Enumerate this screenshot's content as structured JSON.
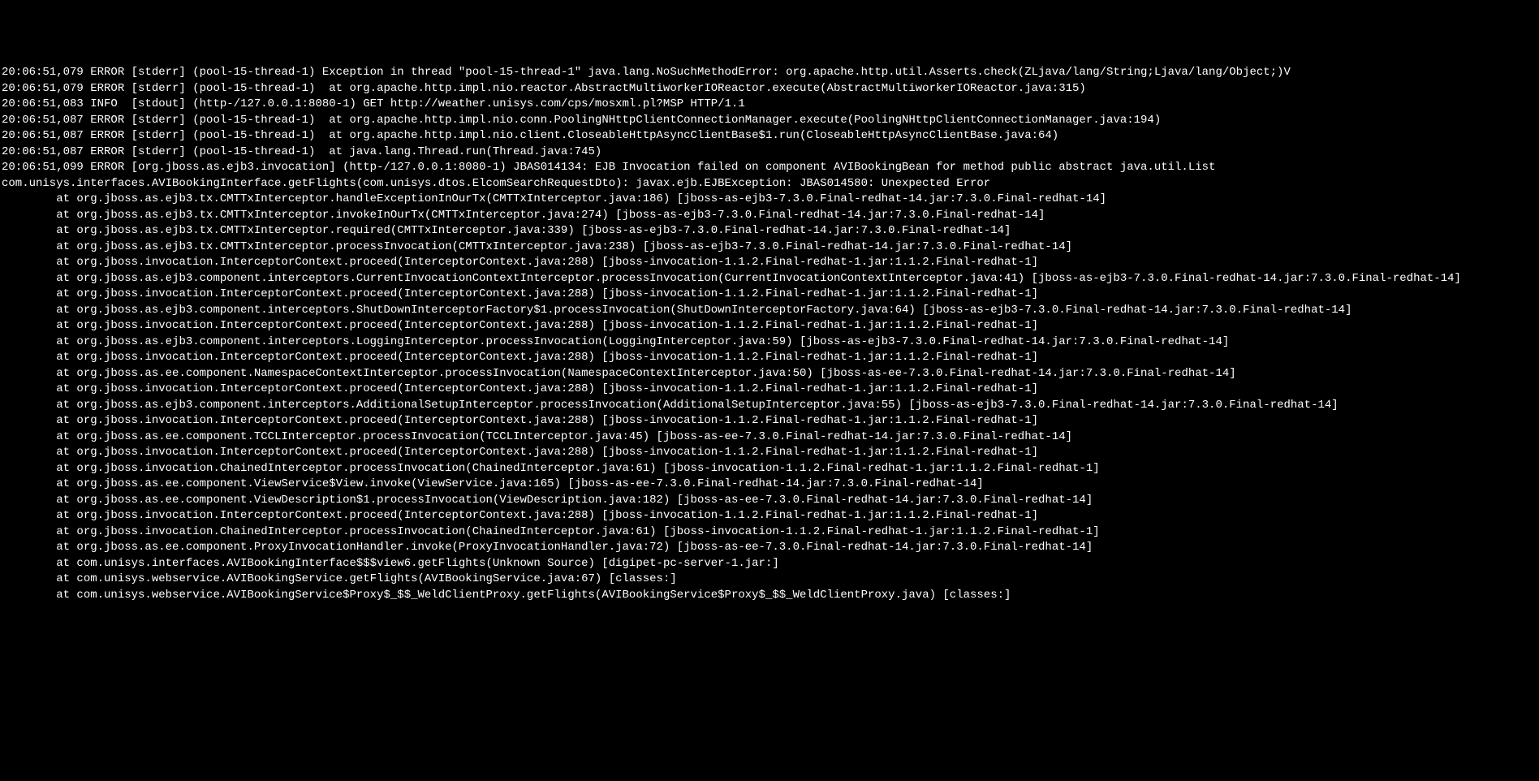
{
  "logLines": [
    "20:06:51,079 ERROR [stderr] (pool-15-thread-1) Exception in thread \"pool-15-thread-1\" java.lang.NoSuchMethodError: org.apache.http.util.Asserts.check(ZLjava/lang/String;Ljava/lang/Object;)V",
    "20:06:51,079 ERROR [stderr] (pool-15-thread-1)  at org.apache.http.impl.nio.reactor.AbstractMultiworkerIOReactor.execute(AbstractMultiworkerIOReactor.java:315)",
    "20:06:51,083 INFO  [stdout] (http-/127.0.0.1:8080-1) GET http://weather.unisys.com/cps/mosxml.pl?MSP HTTP/1.1",
    "20:06:51,087 ERROR [stderr] (pool-15-thread-1)  at org.apache.http.impl.nio.conn.PoolingNHttpClientConnectionManager.execute(PoolingNHttpClientConnectionManager.java:194)",
    "20:06:51,087 ERROR [stderr] (pool-15-thread-1)  at org.apache.http.impl.nio.client.CloseableHttpAsyncClientBase$1.run(CloseableHttpAsyncClientBase.java:64)",
    "20:06:51,087 ERROR [stderr] (pool-15-thread-1)  at java.lang.Thread.run(Thread.java:745)",
    "20:06:51,099 ERROR [org.jboss.as.ejb3.invocation] (http-/127.0.0.1:8080-1) JBAS014134: EJB Invocation failed on component AVIBookingBean for method public abstract java.util.List com.unisys.interfaces.AVIBookingInterface.getFlights(com.unisys.dtos.ElcomSearchRequestDto): javax.ejb.EJBException: JBAS014580: Unexpected Error",
    "        at org.jboss.as.ejb3.tx.CMTTxInterceptor.handleExceptionInOurTx(CMTTxInterceptor.java:186) [jboss-as-ejb3-7.3.0.Final-redhat-14.jar:7.3.0.Final-redhat-14]",
    "        at org.jboss.as.ejb3.tx.CMTTxInterceptor.invokeInOurTx(CMTTxInterceptor.java:274) [jboss-as-ejb3-7.3.0.Final-redhat-14.jar:7.3.0.Final-redhat-14]",
    "        at org.jboss.as.ejb3.tx.CMTTxInterceptor.required(CMTTxInterceptor.java:339) [jboss-as-ejb3-7.3.0.Final-redhat-14.jar:7.3.0.Final-redhat-14]",
    "        at org.jboss.as.ejb3.tx.CMTTxInterceptor.processInvocation(CMTTxInterceptor.java:238) [jboss-as-ejb3-7.3.0.Final-redhat-14.jar:7.3.0.Final-redhat-14]",
    "        at org.jboss.invocation.InterceptorContext.proceed(InterceptorContext.java:288) [jboss-invocation-1.1.2.Final-redhat-1.jar:1.1.2.Final-redhat-1]",
    "        at org.jboss.as.ejb3.component.interceptors.CurrentInvocationContextInterceptor.processInvocation(CurrentInvocationContextInterceptor.java:41) [jboss-as-ejb3-7.3.0.Final-redhat-14.jar:7.3.0.Final-redhat-14]",
    "        at org.jboss.invocation.InterceptorContext.proceed(InterceptorContext.java:288) [jboss-invocation-1.1.2.Final-redhat-1.jar:1.1.2.Final-redhat-1]",
    "        at org.jboss.as.ejb3.component.interceptors.ShutDownInterceptorFactory$1.processInvocation(ShutDownInterceptorFactory.java:64) [jboss-as-ejb3-7.3.0.Final-redhat-14.jar:7.3.0.Final-redhat-14]",
    "        at org.jboss.invocation.InterceptorContext.proceed(InterceptorContext.java:288) [jboss-invocation-1.1.2.Final-redhat-1.jar:1.1.2.Final-redhat-1]",
    "        at org.jboss.as.ejb3.component.interceptors.LoggingInterceptor.processInvocation(LoggingInterceptor.java:59) [jboss-as-ejb3-7.3.0.Final-redhat-14.jar:7.3.0.Final-redhat-14]",
    "        at org.jboss.invocation.InterceptorContext.proceed(InterceptorContext.java:288) [jboss-invocation-1.1.2.Final-redhat-1.jar:1.1.2.Final-redhat-1]",
    "        at org.jboss.as.ee.component.NamespaceContextInterceptor.processInvocation(NamespaceContextInterceptor.java:50) [jboss-as-ee-7.3.0.Final-redhat-14.jar:7.3.0.Final-redhat-14]",
    "        at org.jboss.invocation.InterceptorContext.proceed(InterceptorContext.java:288) [jboss-invocation-1.1.2.Final-redhat-1.jar:1.1.2.Final-redhat-1]",
    "        at org.jboss.as.ejb3.component.interceptors.AdditionalSetupInterceptor.processInvocation(AdditionalSetupInterceptor.java:55) [jboss-as-ejb3-7.3.0.Final-redhat-14.jar:7.3.0.Final-redhat-14]",
    "        at org.jboss.invocation.InterceptorContext.proceed(InterceptorContext.java:288) [jboss-invocation-1.1.2.Final-redhat-1.jar:1.1.2.Final-redhat-1]",
    "        at org.jboss.as.ee.component.TCCLInterceptor.processInvocation(TCCLInterceptor.java:45) [jboss-as-ee-7.3.0.Final-redhat-14.jar:7.3.0.Final-redhat-14]",
    "        at org.jboss.invocation.InterceptorContext.proceed(InterceptorContext.java:288) [jboss-invocation-1.1.2.Final-redhat-1.jar:1.1.2.Final-redhat-1]",
    "        at org.jboss.invocation.ChainedInterceptor.processInvocation(ChainedInterceptor.java:61) [jboss-invocation-1.1.2.Final-redhat-1.jar:1.1.2.Final-redhat-1]",
    "        at org.jboss.as.ee.component.ViewService$View.invoke(ViewService.java:165) [jboss-as-ee-7.3.0.Final-redhat-14.jar:7.3.0.Final-redhat-14]",
    "        at org.jboss.as.ee.component.ViewDescription$1.processInvocation(ViewDescription.java:182) [jboss-as-ee-7.3.0.Final-redhat-14.jar:7.3.0.Final-redhat-14]",
    "        at org.jboss.invocation.InterceptorContext.proceed(InterceptorContext.java:288) [jboss-invocation-1.1.2.Final-redhat-1.jar:1.1.2.Final-redhat-1]",
    "        at org.jboss.invocation.ChainedInterceptor.processInvocation(ChainedInterceptor.java:61) [jboss-invocation-1.1.2.Final-redhat-1.jar:1.1.2.Final-redhat-1]",
    "        at org.jboss.as.ee.component.ProxyInvocationHandler.invoke(ProxyInvocationHandler.java:72) [jboss-as-ee-7.3.0.Final-redhat-14.jar:7.3.0.Final-redhat-14]",
    "        at com.unisys.interfaces.AVIBookingInterface$$$view6.getFlights(Unknown Source) [digipet-pc-server-1.jar:]",
    "        at com.unisys.webservice.AVIBookingService.getFlights(AVIBookingService.java:67) [classes:]",
    "        at com.unisys.webservice.AVIBookingService$Proxy$_$$_WeldClientProxy.getFlights(AVIBookingService$Proxy$_$$_WeldClientProxy.java) [classes:]"
  ]
}
